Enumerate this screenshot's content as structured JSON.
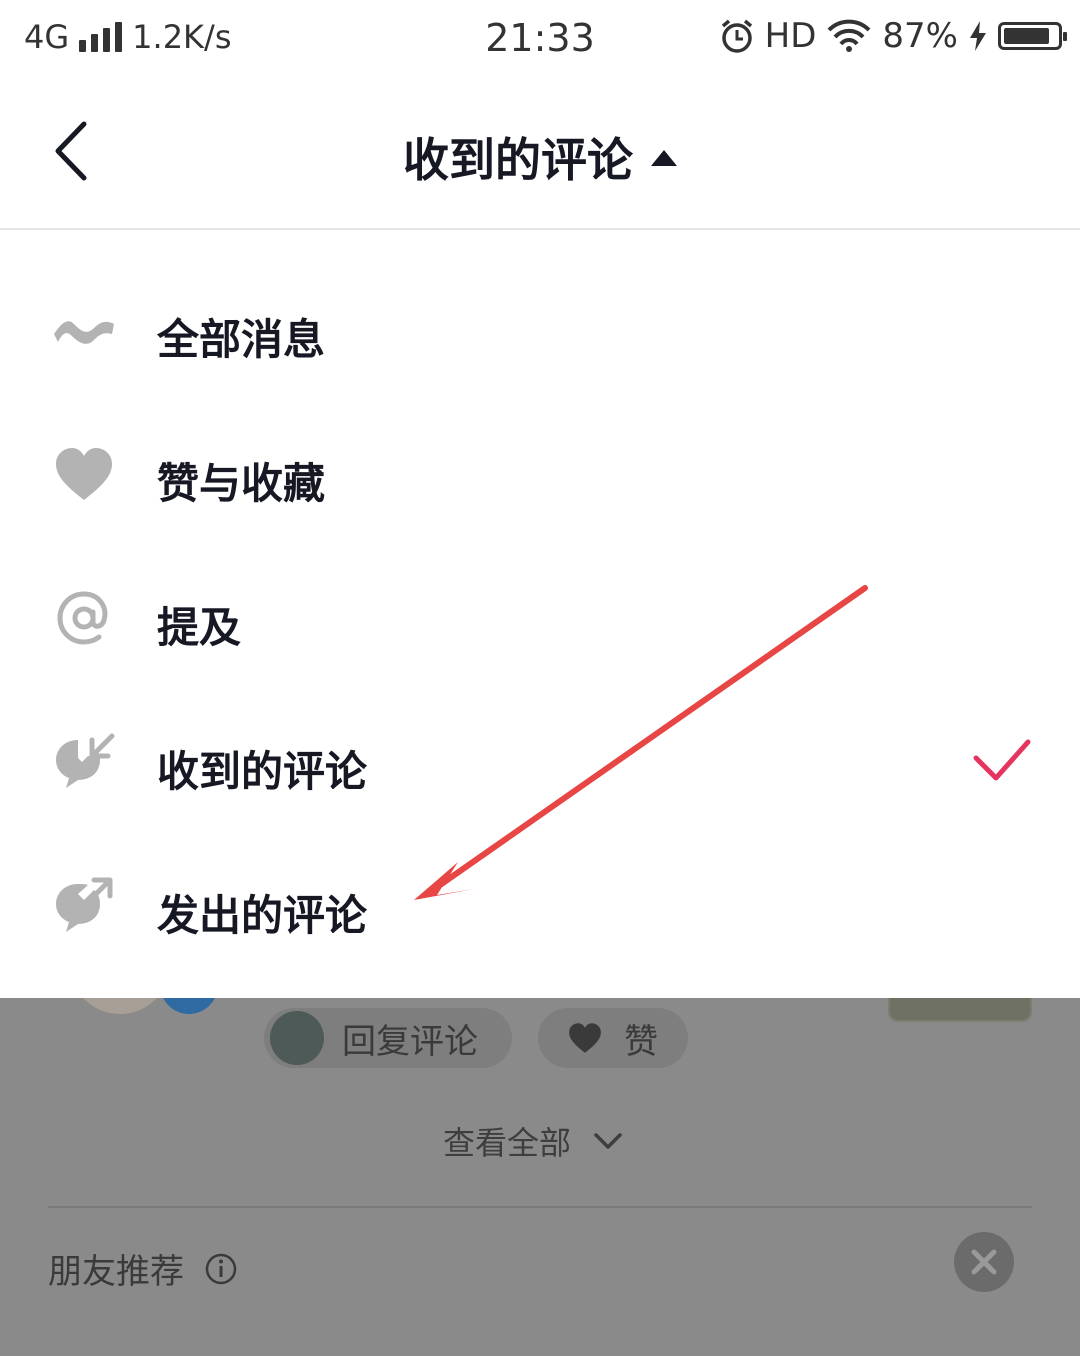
{
  "status_bar": {
    "network": "4G",
    "speed": "1.2K/s",
    "time": "21:33",
    "hd": "HD",
    "battery_percent": "87%",
    "battery_level": 0.87
  },
  "header": {
    "title": "收到的评论"
  },
  "menu": {
    "items": [
      {
        "label": "全部消息",
        "icon": "wave-icon"
      },
      {
        "label": "赞与收藏",
        "icon": "heart-icon"
      },
      {
        "label": "提及",
        "icon": "at-icon"
      },
      {
        "label": "收到的评论",
        "icon": "comment-received-icon",
        "selected": true
      },
      {
        "label": "发出的评论",
        "icon": "comment-sent-icon"
      }
    ],
    "selected_color": "#e5345f",
    "icon_color": "#b3b3b3"
  },
  "background": {
    "reply_label": "回复评论",
    "like_label": "赞",
    "view_all": "查看全部",
    "friends_recommend": "朋友推荐"
  },
  "annotation": {
    "arrow_color": "#e84545"
  }
}
